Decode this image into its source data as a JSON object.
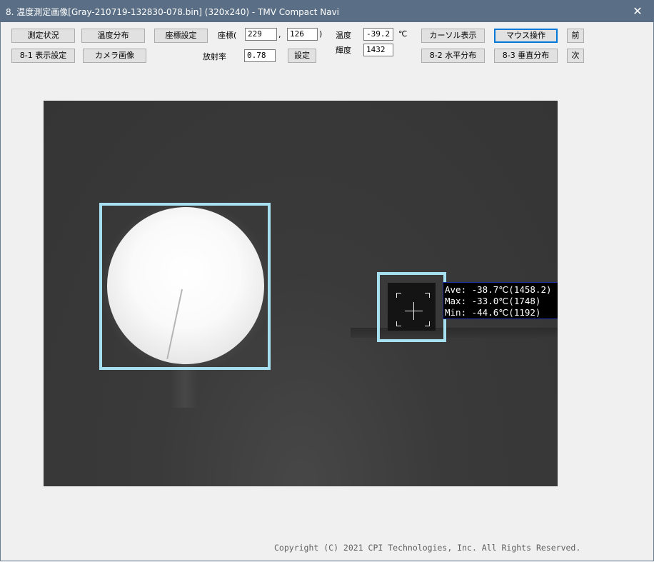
{
  "window": {
    "title": "8. 温度測定画像[Gray-210719-132830-078.bin] (320x240) - TMV Compact Navi",
    "close_glyph": "✕"
  },
  "toolbar": {
    "btn_measure_status": "測定状況",
    "btn_temp_distribution": "温度分布",
    "btn_coord_setting": "座標設定",
    "btn_display_setting": "8-1 表示設定",
    "btn_camera_image": "カメラ画像",
    "coord_label_open": "座標(",
    "coord_x": "229",
    "coord_sep": ",",
    "coord_y": "126",
    "coord_label_close": ")",
    "emissivity_label": "放射率",
    "emissivity_value": "0.78",
    "btn_set": "設定",
    "temp_label": "温度",
    "temp_value": "-39.2",
    "temp_unit": "℃",
    "brightness_label": "輝度",
    "brightness_value": "1432",
    "btn_cursor_display": "カーソル表示",
    "btn_mouse_operation": "マウス操作",
    "btn_horizontal_dist": "8-2 水平分布",
    "btn_vertical_dist": "8-3 垂直分布",
    "btn_prev": "前",
    "btn_next": "次"
  },
  "readout": {
    "ave": "Ave: -38.7℃(1458.2)",
    "max": "Max: -33.0℃(1748)",
    "min": "Min: -44.6℃(1192)"
  },
  "footer": {
    "copyright": "Copyright (C) 2021 CPI Technologies, Inc. All Rights Reserved."
  },
  "colors": {
    "titlebar": "#5a6f86",
    "roi_box": "#a6dff0",
    "default_button_border": "#0078d7"
  }
}
